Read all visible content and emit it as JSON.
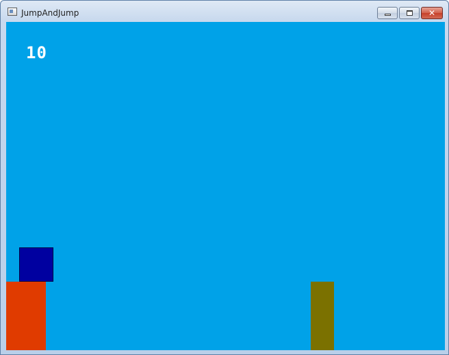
{
  "window": {
    "title": "JumpAndJump",
    "controls": {
      "minimize_icon": "minimize-icon",
      "maximize_icon": "maximize-icon",
      "close_icon": "close-icon",
      "close_glyph": "✕"
    }
  },
  "game": {
    "score": "10",
    "colors": {
      "background": "#00a2e8",
      "current_platform": "#e03b00",
      "target_platform": "#7b7100",
      "player": "#0000a0",
      "score_text": "#ffffff"
    }
  }
}
